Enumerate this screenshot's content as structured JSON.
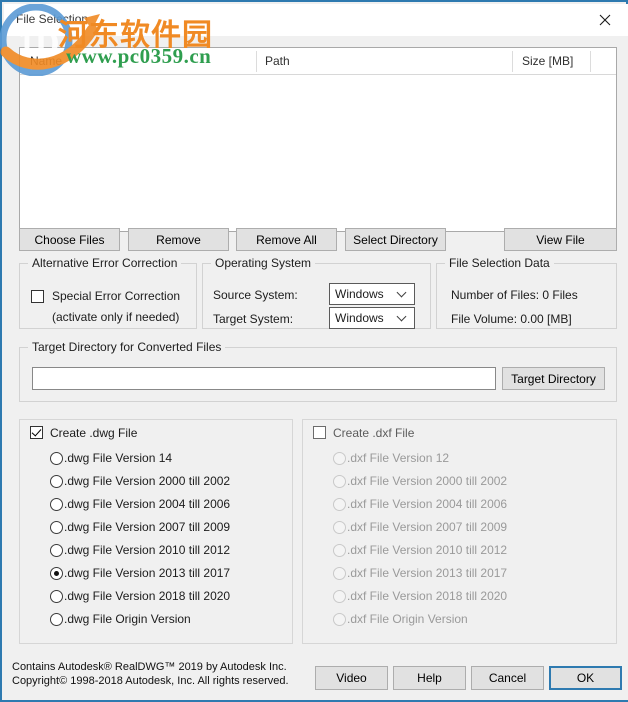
{
  "window": {
    "title": "File Selection",
    "close_icon": "close-icon",
    "frame_color": "#2e7ab0"
  },
  "watermark": {
    "chinese": "河东软件园",
    "url": "www.pc0359.cn",
    "logo_icon": "pc0359-logo-icon",
    "chinese_color": "#f08a24",
    "url_color": "#2f9e4f"
  },
  "file_list": {
    "columns": [
      "Name",
      "Path",
      "Size [MB]"
    ],
    "rows": []
  },
  "toolbar": {
    "choose_files": "Choose Files",
    "remove": "Remove",
    "remove_all": "Remove All",
    "select_directory": "Select Directory",
    "view_file": "View File"
  },
  "alt_error_correction": {
    "title": "Alternative Error Correction",
    "checkbox_label": "Special Error Correction",
    "checkbox_checked": false,
    "hint": "(activate only if needed)"
  },
  "operating_system": {
    "title": "Operating System",
    "source_label": "Source System:",
    "source_value": "Windows",
    "target_label": "Target System:",
    "target_value": "Windows",
    "options": [
      "Windows"
    ]
  },
  "file_selection_data": {
    "title": "File Selection Data",
    "number_of_files": "Number of Files: 0 Files",
    "file_volume": "File Volume: 0.00 [MB]"
  },
  "target_directory": {
    "title": "Target Directory for Converted Files",
    "path_value": "",
    "path_placeholder": "",
    "button_label": "Target Directory"
  },
  "dwg_panel": {
    "checkbox_label": "Create .dwg File",
    "checkbox_checked": true,
    "enabled": true,
    "selected_index": 5,
    "options": [
      ".dwg File Version 14",
      ".dwg File Version 2000 till 2002",
      ".dwg File Version 2004 till 2006",
      ".dwg File Version 2007 till 2009",
      ".dwg File Version 2010 till 2012",
      ".dwg File Version 2013 till 2017",
      ".dwg File Version 2018 till 2020",
      ".dwg File Origin Version"
    ]
  },
  "dxf_panel": {
    "checkbox_label": "Create .dxf File",
    "checkbox_checked": false,
    "enabled": false,
    "selected_index": -1,
    "options": [
      ".dxf File Version 12",
      ".dxf File Version 2000 till 2002",
      ".dxf File Version 2004 till 2006",
      ".dxf File Version 2007 till 2009",
      ".dxf File Version 2010 till 2012",
      ".dxf File  Version 2013 till 2017",
      ".dxf File Version 2018 till 2020",
      ".dxf File Origin Version"
    ]
  },
  "footer": {
    "copyright_line1": "Contains Autodesk® RealDWG™ 2019 by Autodesk Inc.",
    "copyright_line2": "Copyright© 1998-2018 Autodesk, Inc. All rights reserved.",
    "video": "Video",
    "help": "Help",
    "cancel": "Cancel",
    "ok": "OK"
  }
}
